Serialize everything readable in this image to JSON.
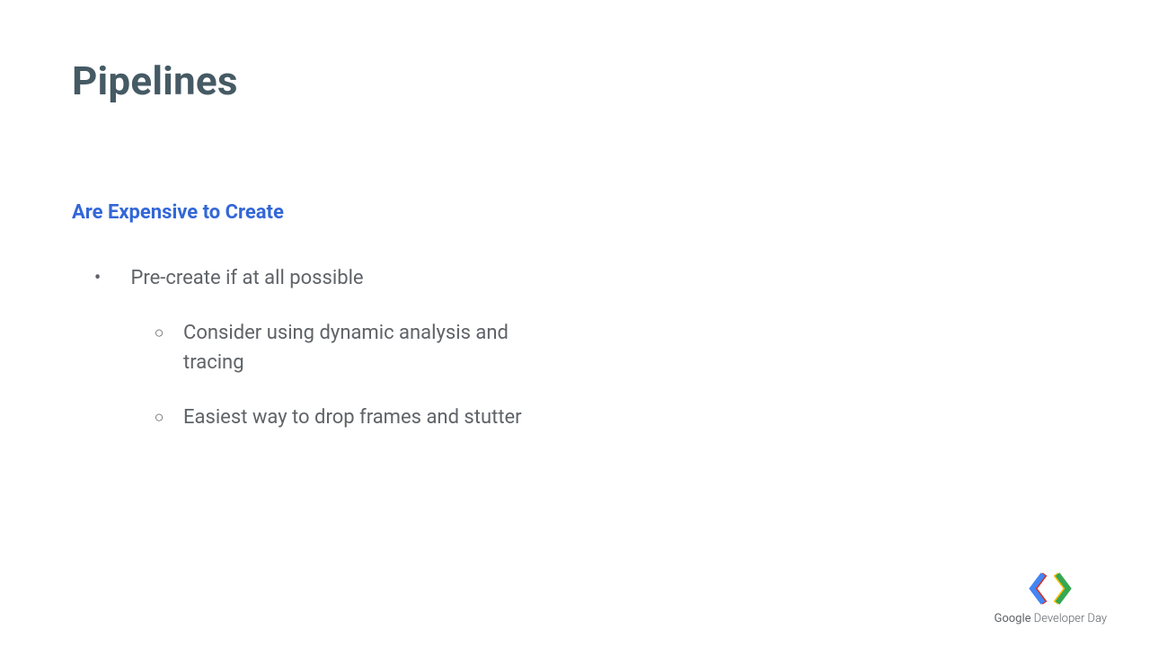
{
  "slide": {
    "title": "Pipelines",
    "subtitle": "Are Expensive to Create",
    "bullets": {
      "main": "Pre-create if at all possible",
      "sub1": "Consider using dynamic analysis and tracing",
      "sub2": "Easiest way to drop frames and stutter"
    }
  },
  "footer": {
    "brand_a": "Google",
    "brand_b": " Developer Day"
  }
}
